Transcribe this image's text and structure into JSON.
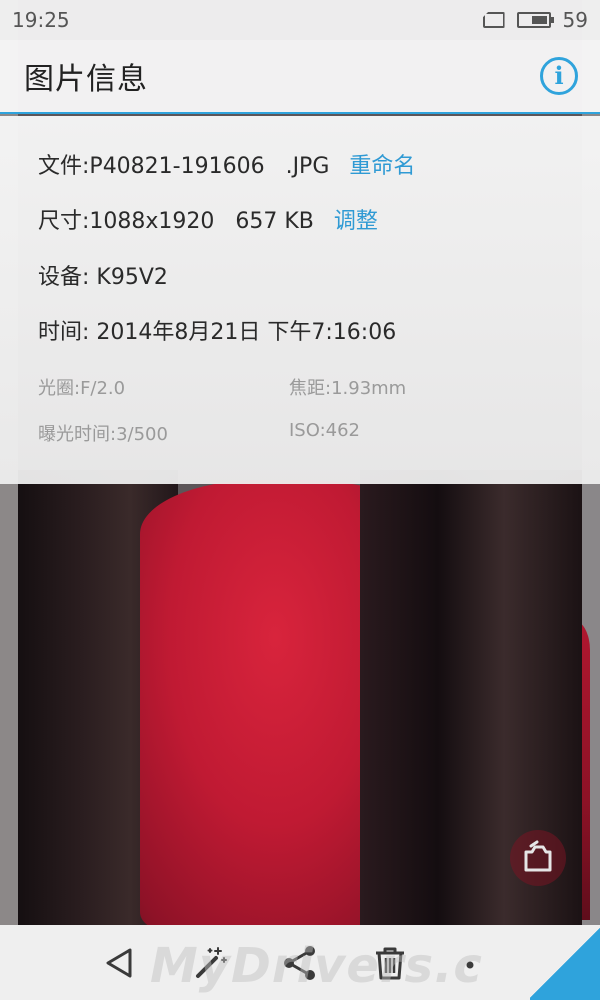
{
  "status_bar": {
    "time": "19:25",
    "battery": "59",
    "battery_level_percent": 59
  },
  "header": {
    "title": "图片信息",
    "info_icon": "info-icon"
  },
  "details": {
    "file_label": "文件:",
    "file_value": "P40821-191606   .JPG",
    "rename_link": "重命名",
    "size_label": "尺寸:",
    "size_value": "1088x1920   657 KB",
    "adjust_link": "调整",
    "device": "设备: K95V2",
    "time": "时间: 2014年8月21日 下午7:16:06",
    "aperture": "光圈:F/2.0",
    "focal_length": "焦距:1.93mm",
    "exposure": "曝光时间:3/500",
    "iso": "ISO:462"
  },
  "nav": {
    "back_icon": "back-triangle-icon",
    "edit_icon": "magic-wand-icon",
    "share_icon": "share-icon",
    "delete_icon": "trash-icon",
    "more_icon": "more-dots-icon"
  },
  "watermark": "MyDrivers.c",
  "colors": {
    "accent": "#2fa3dc",
    "link": "#2f9ad4",
    "meta_text": "#9a9a9a"
  }
}
